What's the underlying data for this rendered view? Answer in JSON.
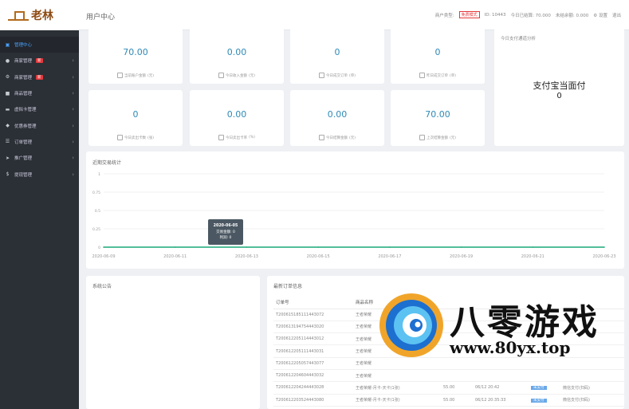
{
  "header": {
    "logo_text": "老林",
    "page_title": "用户中心",
    "merchant_type_label": "商户类型:",
    "merchant_type_value": "免费模式",
    "id_text": "ID: 10443",
    "today_income": "今日已结算: 70.000",
    "unsettled": "未结余额: 0.000",
    "settings": "设置",
    "logout": "退出"
  },
  "sidebar": {
    "items": [
      {
        "label": "管理中心",
        "icon": "home-icon",
        "active": true
      },
      {
        "label": "商家管理",
        "icon": "user-icon",
        "badge": "新"
      },
      {
        "label": "商家管理",
        "icon": "gear-icon",
        "badge": "新"
      },
      {
        "label": "商品管理",
        "icon": "bag-icon"
      },
      {
        "label": "虚拟卡管理",
        "icon": "card-icon"
      },
      {
        "label": "优惠券管理",
        "icon": "tag-icon"
      },
      {
        "label": "订单管理",
        "icon": "list-icon"
      },
      {
        "label": "推广管理",
        "icon": "send-icon"
      },
      {
        "label": "提现管理",
        "icon": "dollar-icon"
      }
    ]
  },
  "stats": [
    {
      "value": "70.00",
      "label": "当前账户金额",
      "unit": "(元)"
    },
    {
      "value": "0.00",
      "label": "今日收入金额",
      "unit": "(元)"
    },
    {
      "value": "0",
      "label": "今日成交订单",
      "unit": "(单)"
    },
    {
      "value": "0",
      "label": "昨日成交订单",
      "unit": "(单)"
    },
    {
      "value": "0",
      "label": "今日卖出卡数",
      "unit": "(张)"
    },
    {
      "value": "0.00",
      "label": "今日卖出卡率",
      "unit": "(%)"
    },
    {
      "value": "0.00",
      "label": "今日结算金额",
      "unit": "(元)"
    },
    {
      "value": "70.00",
      "label": "上次结算金额",
      "unit": "(元)"
    }
  ],
  "pay_summary": {
    "title": "今日支付通道分析",
    "channel": "支付宝当面付",
    "value": "0"
  },
  "chart_title": "近期交易统计",
  "chart_data": {
    "type": "line",
    "x": [
      "2020-06-09",
      "2020-06-11",
      "2020-06-13",
      "2020-06-15",
      "2020-06-17",
      "2020-06-19",
      "2020-06-21",
      "2020-06-23"
    ],
    "x_ticks_shown": [
      "2020-06-09",
      "2020-06-11",
      "2020-06-13",
      "2020-06-15",
      "2020-06-17",
      "2020-06-19",
      "2020-06-21",
      "2020-06-23"
    ],
    "series": [
      {
        "name": "交易金额",
        "values": [
          0,
          0,
          0,
          0,
          0,
          0,
          0,
          0
        ]
      }
    ],
    "ylim": [
      0,
      1
    ],
    "y_ticks": [
      "0",
      "0.25",
      "0.5",
      "0.75",
      "1"
    ],
    "tooltip": {
      "date": "2020-06-05",
      "line1": "交易金额: 0",
      "line2": "利润: 0"
    },
    "color": "#1aa97a"
  },
  "notice_title": "系统公告",
  "orders": {
    "title": "最新订单信息",
    "col_order": "订单号",
    "col_product": "商品名称",
    "rows": [
      {
        "id": "T200615185111443072",
        "product": "王者荣耀"
      },
      {
        "id": "T200613194754443020",
        "product": "王者荣耀"
      },
      {
        "id": "T200612205114443012",
        "product": "王者荣耀"
      },
      {
        "id": "T200612205111443031",
        "product": "王者荣耀"
      },
      {
        "id": "T200612205057443077",
        "product": "王者荣耀"
      },
      {
        "id": "T200612204604443032",
        "product": "王者荣耀"
      },
      {
        "id": "T200612204244443028",
        "product": "王者荣耀-月卡-天卡(1张)",
        "amount": "55.00",
        "time": "06/12 20:42",
        "status": "未支付",
        "channel": "微信支付(扫码)"
      },
      {
        "id": "T200612203524443080",
        "product": "王者荣耀-月卡-天卡(1张)",
        "amount": "55.00",
        "time": "06/12 20:35:33",
        "status": "未支付",
        "channel": "微信支付(扫码)"
      }
    ]
  },
  "watermark": {
    "title": "八零游戏",
    "url": "www.80yx.top"
  }
}
